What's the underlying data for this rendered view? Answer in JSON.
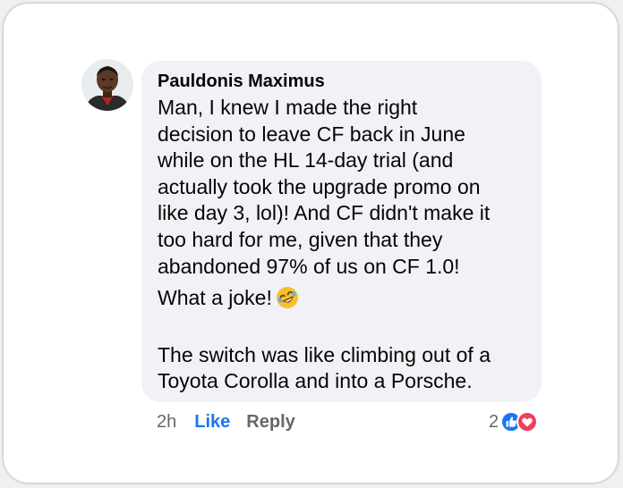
{
  "comment": {
    "author": "Pauldonis Maximus",
    "paragraphs": [
      [
        "Man, I knew I made the right",
        "decision to leave CF back in June",
        "while on the HL 14-day trial (and",
        "actually took the upgrade promo on",
        "like day 3, lol)! And CF didn't make it",
        "too hard for me, given that they",
        "abandoned 97% of us on CF 1.0!"
      ],
      [
        "What a joke!"
      ],
      [
        "The switch was like climbing out of a",
        "Toyota Corolla and into a Porsche."
      ]
    ],
    "emoji_icon": "rolling-on-floor-laughing-emoji"
  },
  "actions": {
    "timestamp": "2h",
    "like_label": "Like",
    "reply_label": "Reply"
  },
  "reactions": {
    "count": "2",
    "icons": [
      "like-reaction-icon",
      "love-reaction-icon"
    ]
  },
  "colors": {
    "bubble": "#f0f2f5",
    "like_blue": "#1877f2",
    "love_red": "#f33e58",
    "secondary_text": "#65676b"
  }
}
